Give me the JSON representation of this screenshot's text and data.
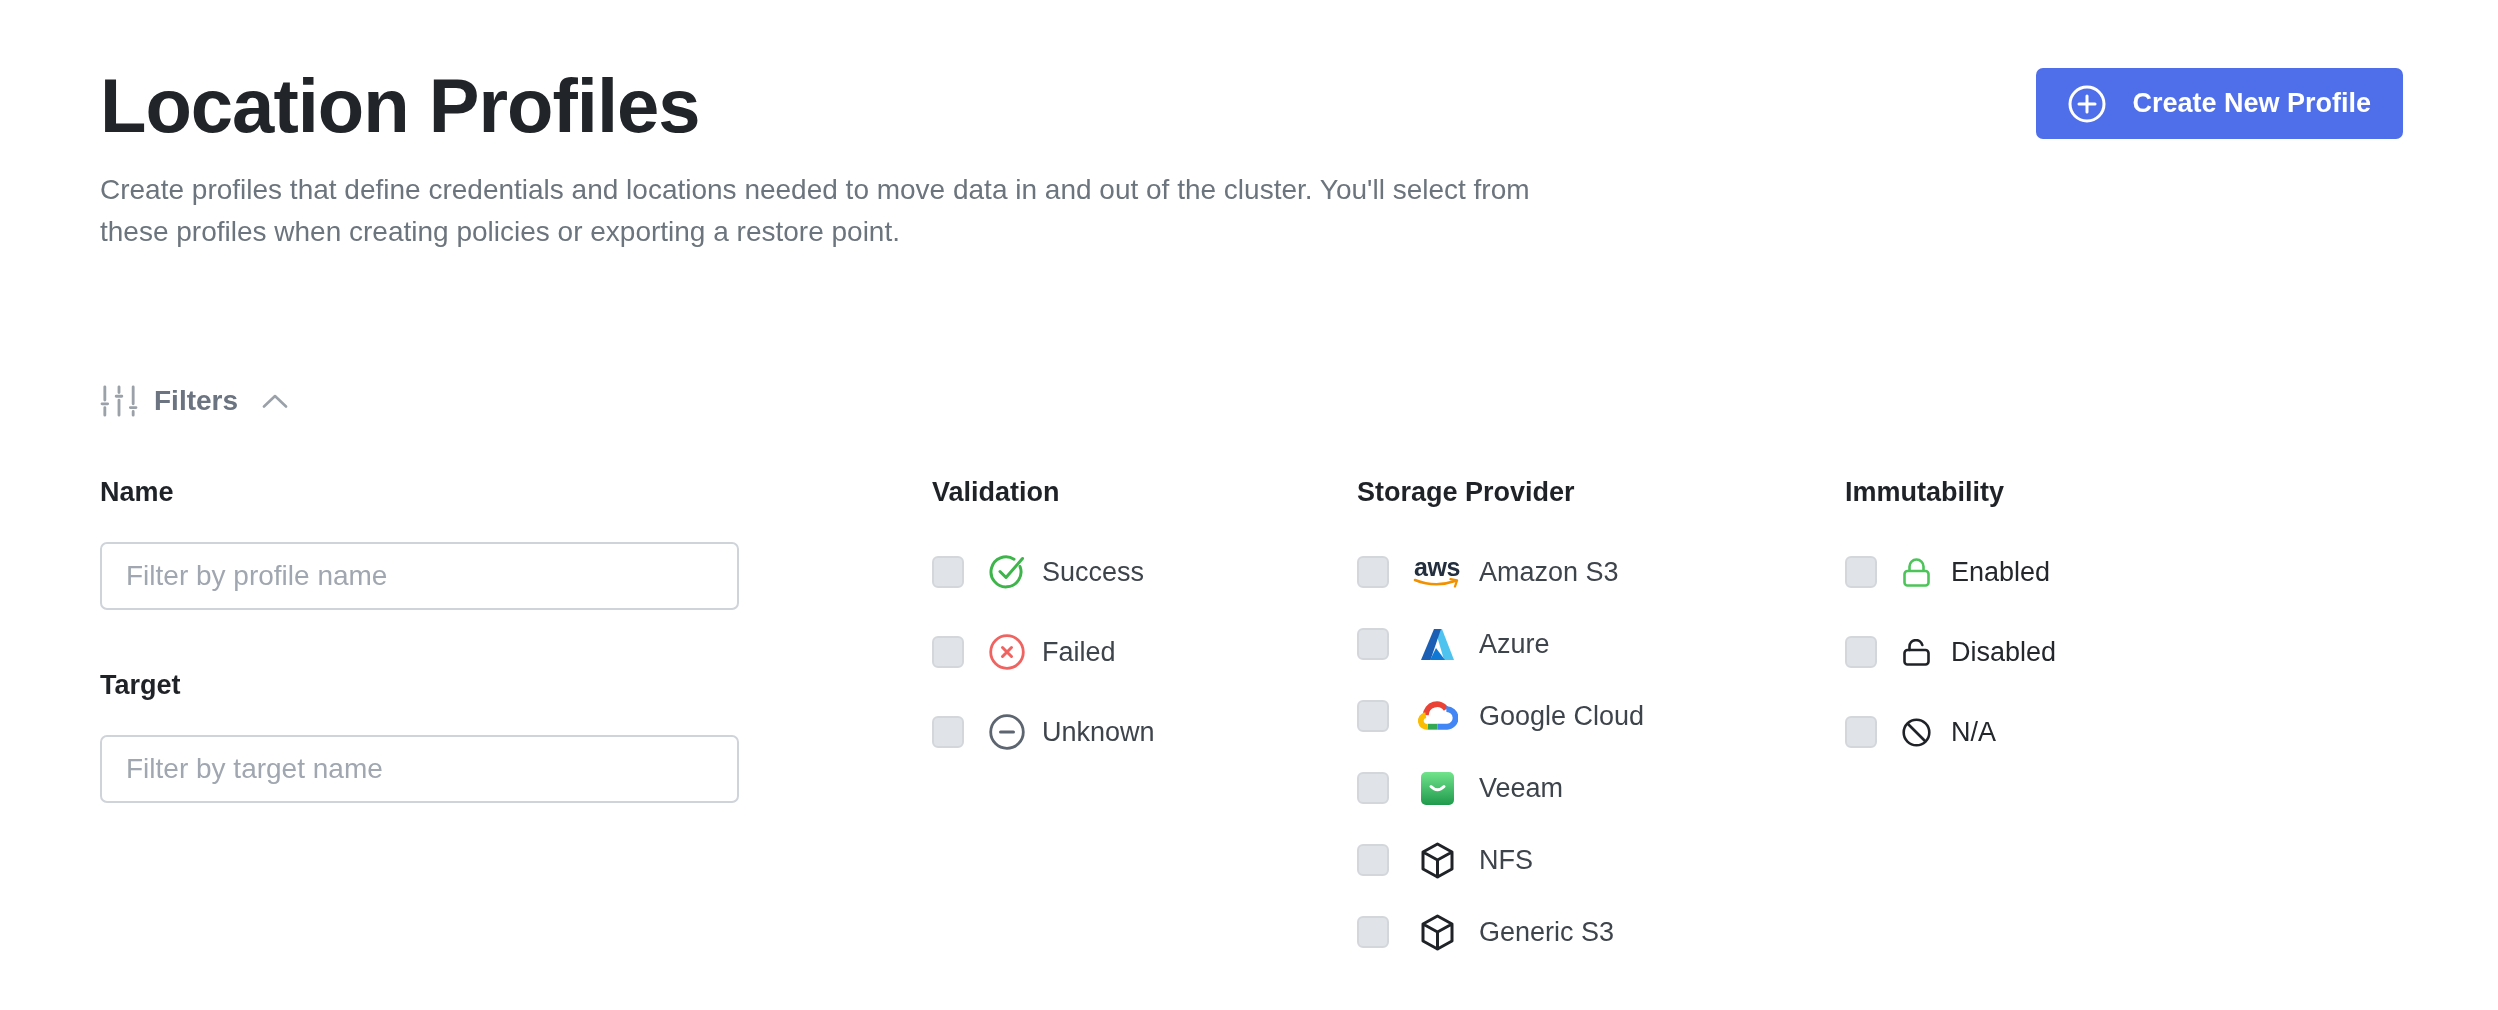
{
  "header": {
    "title": "Location Profiles",
    "description": "Create profiles that define credentials and locations needed to move data in and out of the cluster. You'll select from these profiles when creating policies or exporting a restore point.",
    "create_button": {
      "label": "Create New Profile"
    }
  },
  "filters": {
    "label": "Filters",
    "expanded": true,
    "text_fields": [
      {
        "label": "Name",
        "placeholder": "Filter by profile name"
      },
      {
        "label": "Target",
        "placeholder": "Filter by target name"
      }
    ],
    "groups": [
      {
        "title": "Validation",
        "options": [
          {
            "label": "Success",
            "kind": "success",
            "checked": false
          },
          {
            "label": "Failed",
            "kind": "failed",
            "checked": false
          },
          {
            "label": "Unknown",
            "kind": "unknown",
            "checked": false
          }
        ]
      },
      {
        "title": "Storage Provider",
        "options": [
          {
            "label": "Amazon S3",
            "kind": "aws",
            "logo_text": "aws",
            "checked": false
          },
          {
            "label": "Azure",
            "kind": "azure",
            "checked": false
          },
          {
            "label": "Google Cloud",
            "kind": "gcloud",
            "checked": false
          },
          {
            "label": "Veeam",
            "kind": "veeam",
            "checked": false
          },
          {
            "label": "NFS",
            "kind": "cube",
            "checked": false
          },
          {
            "label": "Generic S3",
            "kind": "cube",
            "checked": false
          }
        ]
      },
      {
        "title": "Immutability",
        "options": [
          {
            "label": "Enabled",
            "kind": "locked",
            "checked": false
          },
          {
            "label": "Disabled",
            "kind": "unlocked",
            "checked": false
          },
          {
            "label": "N/A",
            "kind": "none",
            "checked": false
          }
        ]
      }
    ]
  }
}
